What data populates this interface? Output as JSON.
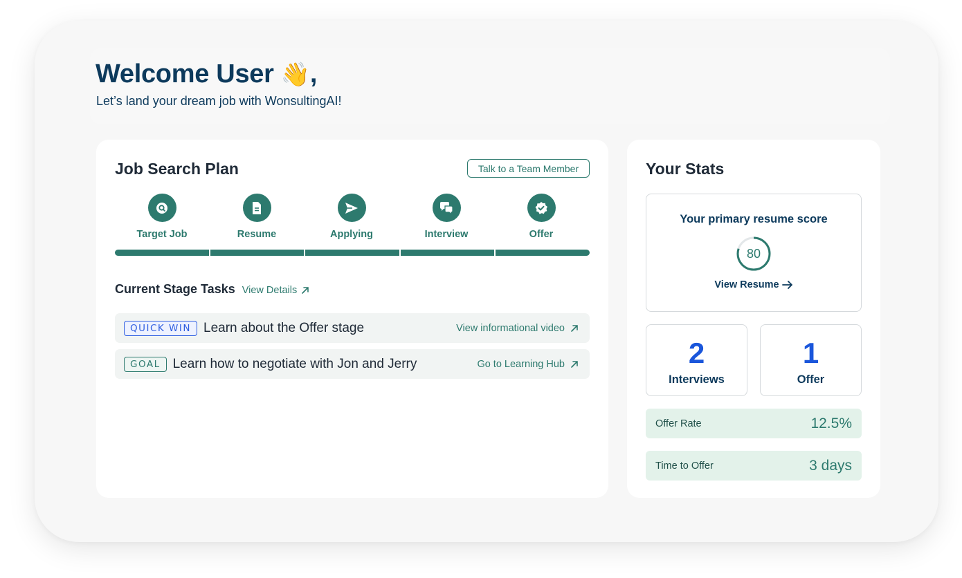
{
  "welcome": {
    "title": "Welcome User",
    "emoji": "👋",
    "comma": ",",
    "subtitle": "Let’s land your dream job with WonsultingAI!"
  },
  "plan": {
    "title": "Job Search Plan",
    "talk_button": "Talk to a Team Member",
    "stages": [
      {
        "label": "Target Job",
        "icon": "target-search-icon"
      },
      {
        "label": "Resume",
        "icon": "document-icon"
      },
      {
        "label": "Applying",
        "icon": "send-icon"
      },
      {
        "label": "Interview",
        "icon": "chat-bubbles-icon"
      },
      {
        "label": "Offer",
        "icon": "check-badge-icon"
      }
    ],
    "progress_fraction": 1.0,
    "tasks_title": "Current Stage Tasks",
    "view_details": "View Details",
    "tasks": [
      {
        "badge": "QUICK WIN",
        "text": "Learn about the Offer stage",
        "link": "View informational video"
      },
      {
        "badge": "GOAL",
        "text": "Learn how to negotiate with Jon and Jerry",
        "link": "Go to Learning Hub"
      }
    ]
  },
  "stats": {
    "title": "Your Stats",
    "score_title": "Your primary resume score",
    "score": "80",
    "score_fraction": 0.8,
    "view_resume": "View Resume",
    "interviews_count": "2",
    "interviews_label": "Interviews",
    "offers_count": "1",
    "offers_label": "Offer",
    "offer_rate_label": "Offer Rate",
    "offer_rate_value": "12.5%",
    "time_to_offer_label": "Time to Offer",
    "time_to_offer_value": "3 days"
  },
  "colors": {
    "primary_teal": "#2d7a6e",
    "navy": "#0d3a5c",
    "accent_blue": "#1a56db",
    "metric_bg": "#e3f2ea"
  }
}
